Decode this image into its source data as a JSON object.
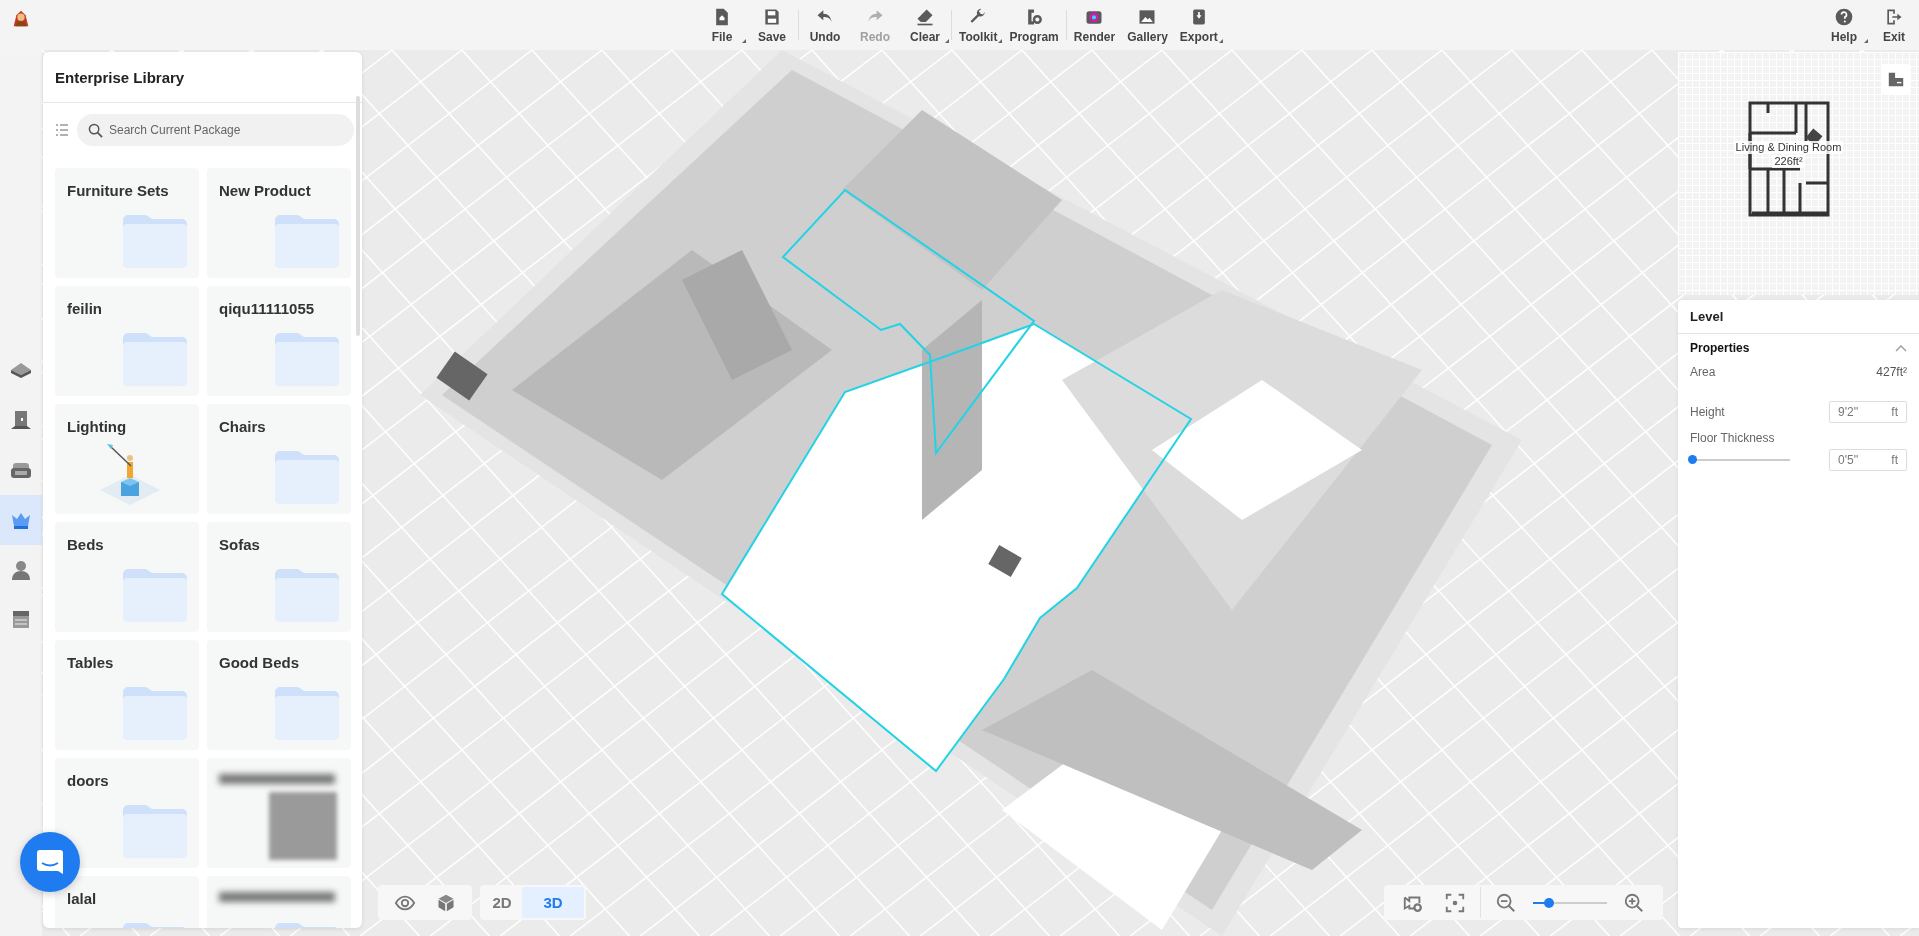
{
  "toolbar": {
    "groups": [
      {
        "items": [
          {
            "label": "File",
            "has_menu": true,
            "disabled": false
          },
          {
            "label": "Save",
            "has_menu": false,
            "disabled": false
          }
        ]
      },
      {
        "items": [
          {
            "label": "Undo",
            "has_menu": false,
            "disabled": false
          },
          {
            "label": "Redo",
            "has_menu": false,
            "disabled": true
          },
          {
            "label": "Clear",
            "has_menu": true,
            "disabled": false
          }
        ]
      },
      {
        "items": [
          {
            "label": "Toolkit",
            "has_menu": true,
            "disabled": false
          },
          {
            "label": "Program",
            "has_menu": false,
            "disabled": false
          }
        ]
      },
      {
        "items": [
          {
            "label": "Render",
            "has_menu": false,
            "disabled": false
          },
          {
            "label": "Gallery",
            "has_menu": false,
            "disabled": false
          },
          {
            "label": "Export",
            "has_menu": true,
            "disabled": false
          }
        ]
      }
    ],
    "right": [
      {
        "label": "Help",
        "has_menu": true
      },
      {
        "label": "Exit",
        "has_menu": false
      }
    ]
  },
  "rail": [
    {
      "selected": false
    },
    {
      "selected": false
    },
    {
      "selected": false
    },
    {
      "selected": true
    },
    {
      "selected": false
    },
    {
      "selected": false
    }
  ],
  "library": {
    "title": "Enterprise Library",
    "search": {
      "placeholder": "Search Current Package"
    },
    "cards": [
      {
        "kind": "folder",
        "label": "Furniture Sets"
      },
      {
        "kind": "folder",
        "label": "New Product"
      },
      {
        "kind": "folder",
        "label": "feilin"
      },
      {
        "kind": "folder",
        "label": "qiqu11111055"
      },
      {
        "kind": "illustration",
        "label": "Lighting"
      },
      {
        "kind": "folder",
        "label": "Chairs"
      },
      {
        "kind": "folder",
        "label": "Beds"
      },
      {
        "kind": "folder",
        "label": "Sofas"
      },
      {
        "kind": "folder",
        "label": "Tables"
      },
      {
        "kind": "folder",
        "label": "Good Beds"
      },
      {
        "kind": "folder",
        "label": "doors"
      },
      {
        "kind": "blurred-image"
      },
      {
        "kind": "folder",
        "label": "lalal"
      },
      {
        "kind": "blurred-folder"
      }
    ]
  },
  "minimap": {
    "room": "Living & Dining Room",
    "area": "226ft²"
  },
  "level_panel": {
    "title": "Level",
    "section": {
      "title": "Properties",
      "expanded": true
    },
    "area": {
      "label": "Area",
      "value": "427ft²"
    },
    "height": {
      "label": "Height",
      "value": "9'2''",
      "unit": "ft"
    },
    "floor_thickness": {
      "label": "Floor Thickness",
      "level": 0.02,
      "value": "0'5''",
      "unit": "ft"
    }
  },
  "view_modes": [
    {
      "label": "2D",
      "selected": false
    },
    {
      "label": "3D",
      "selected": true
    }
  ],
  "zoom": {
    "level": 0.22
  }
}
